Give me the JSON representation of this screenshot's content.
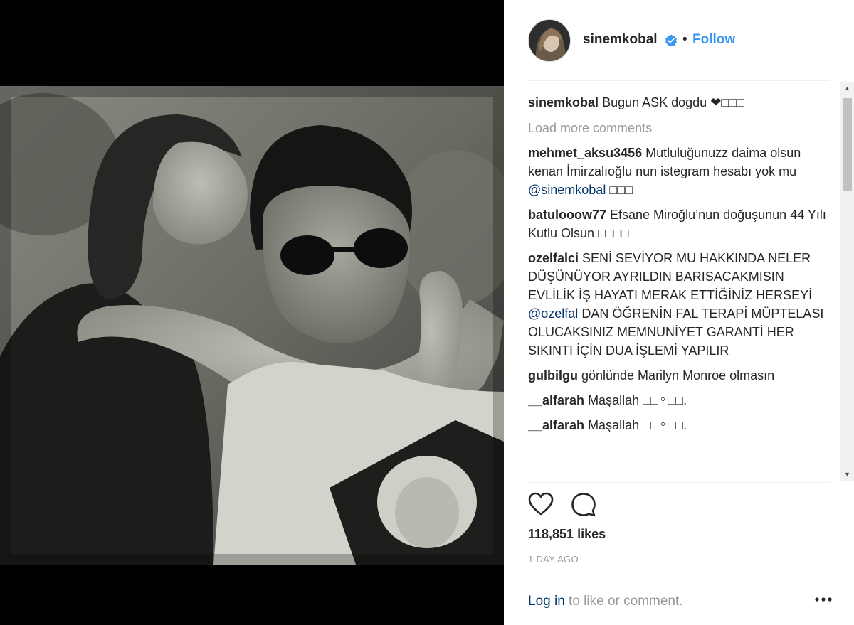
{
  "post": {
    "username": "sinemkobal",
    "follow_label": "Follow",
    "separator": "•",
    "caption_text": "Bugun ASK dogdu ❤□□□",
    "load_more": "Load more comments",
    "likes": "118,851 likes",
    "time_ago": "1 DAY AGO",
    "login_link": "Log in",
    "login_rest": " to like or comment."
  },
  "comments": [
    {
      "user": "mehmet_aksu3456",
      "text_before": " Mutluluğunuzz daima olsun kenan İmirzalıoğlu nun istegram hesabı yok mu ",
      "mention": "@sinemkobal",
      "text_after": " □□□"
    },
    {
      "user": "batulooow77",
      "text_before": " Efsane Miroğlu’nun doğuşunun 44 Yılı Kutlu Olsun □□□□",
      "mention": "",
      "text_after": ""
    },
    {
      "user": "ozelfalci",
      "text_before": " SENİ SEVİYOR MU HAKKINDA NELER DÜŞÜNÜYOR AYRILDIN BARISACAKMISIN EVLİLİK İŞ HAYATI MERAK ETTİĞİNİZ HERSEYİ ",
      "mention": "@ozelfal",
      "text_after": " DAN ÖĞRENİN FAL TERAPİ MÜPTELASI OLUCAKSINIZ MEMNUNİYET GARANTİ HER SIKINTI İÇİN DUA İŞLEMİ YAPILIR"
    },
    {
      "user": "gulbilgu",
      "text_before": " gönlünde Marilyn Monroe olmasın",
      "mention": "",
      "text_after": ""
    },
    {
      "user": "__alfarah",
      "text_before": " Maşallah □□♀□□.",
      "mention": "",
      "text_after": ""
    },
    {
      "user": "__alfarah",
      "text_before": " Maşallah □□♀□□.",
      "mention": "",
      "text_after": ""
    }
  ],
  "scrollbar": {
    "up_arrow": "▲",
    "down_arrow": "▼"
  },
  "icons": {
    "verified": "verified-badge-icon",
    "heart": "heart-icon",
    "comment": "comment-bubble-icon",
    "more": "more-options-icon"
  },
  "colors": {
    "accent": "#3897f0",
    "mention": "#003569",
    "muted": "#999999",
    "text": "#262626"
  }
}
